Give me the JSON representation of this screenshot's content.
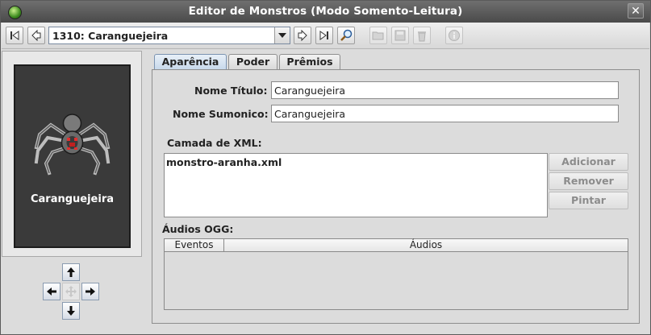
{
  "window": {
    "title": "Editor de Monstros (Modo Somento-Leitura)"
  },
  "toolbar": {
    "selected_monster": "1310: Caranguejeira",
    "buttons": [
      {
        "name": "first-record-icon",
        "enabled": true
      },
      {
        "name": "previous-record-icon",
        "enabled": true
      },
      {
        "name": "next-record-icon",
        "enabled": true
      },
      {
        "name": "last-record-icon",
        "enabled": true
      },
      {
        "name": "search-icon",
        "enabled": true
      },
      {
        "name": "open-folder-icon",
        "enabled": false
      },
      {
        "name": "save-icon",
        "enabled": false
      },
      {
        "name": "delete-icon",
        "enabled": false
      },
      {
        "name": "info-icon",
        "enabled": false
      }
    ]
  },
  "preview": {
    "monster_name": "Caranguejeira",
    "image": "spider-sprite"
  },
  "tabs": [
    {
      "label": "Aparência",
      "active": true
    },
    {
      "label": "Poder",
      "active": false
    },
    {
      "label": "Prêmios",
      "active": false
    }
  ],
  "form": {
    "title_name_label": "Nome Título:",
    "title_name_value": "Caranguejeira",
    "summon_name_label": "Nome Sumonico:",
    "summon_name_value": "Caranguejeira",
    "xml_layer_label": "Camada de XML:",
    "xml_layers": [
      "monstro-aranha.xml"
    ],
    "buttons": {
      "add": "Adicionar",
      "remove": "Remover",
      "paint": "Pintar"
    },
    "ogg_label": "Áudios OGG:",
    "ogg_columns": [
      "Eventos",
      "Áudios"
    ]
  },
  "colors": {
    "accent": "#c6d7ea",
    "portrait_bg": "#3a3a3a",
    "title_bar": "#4a4a4a"
  }
}
